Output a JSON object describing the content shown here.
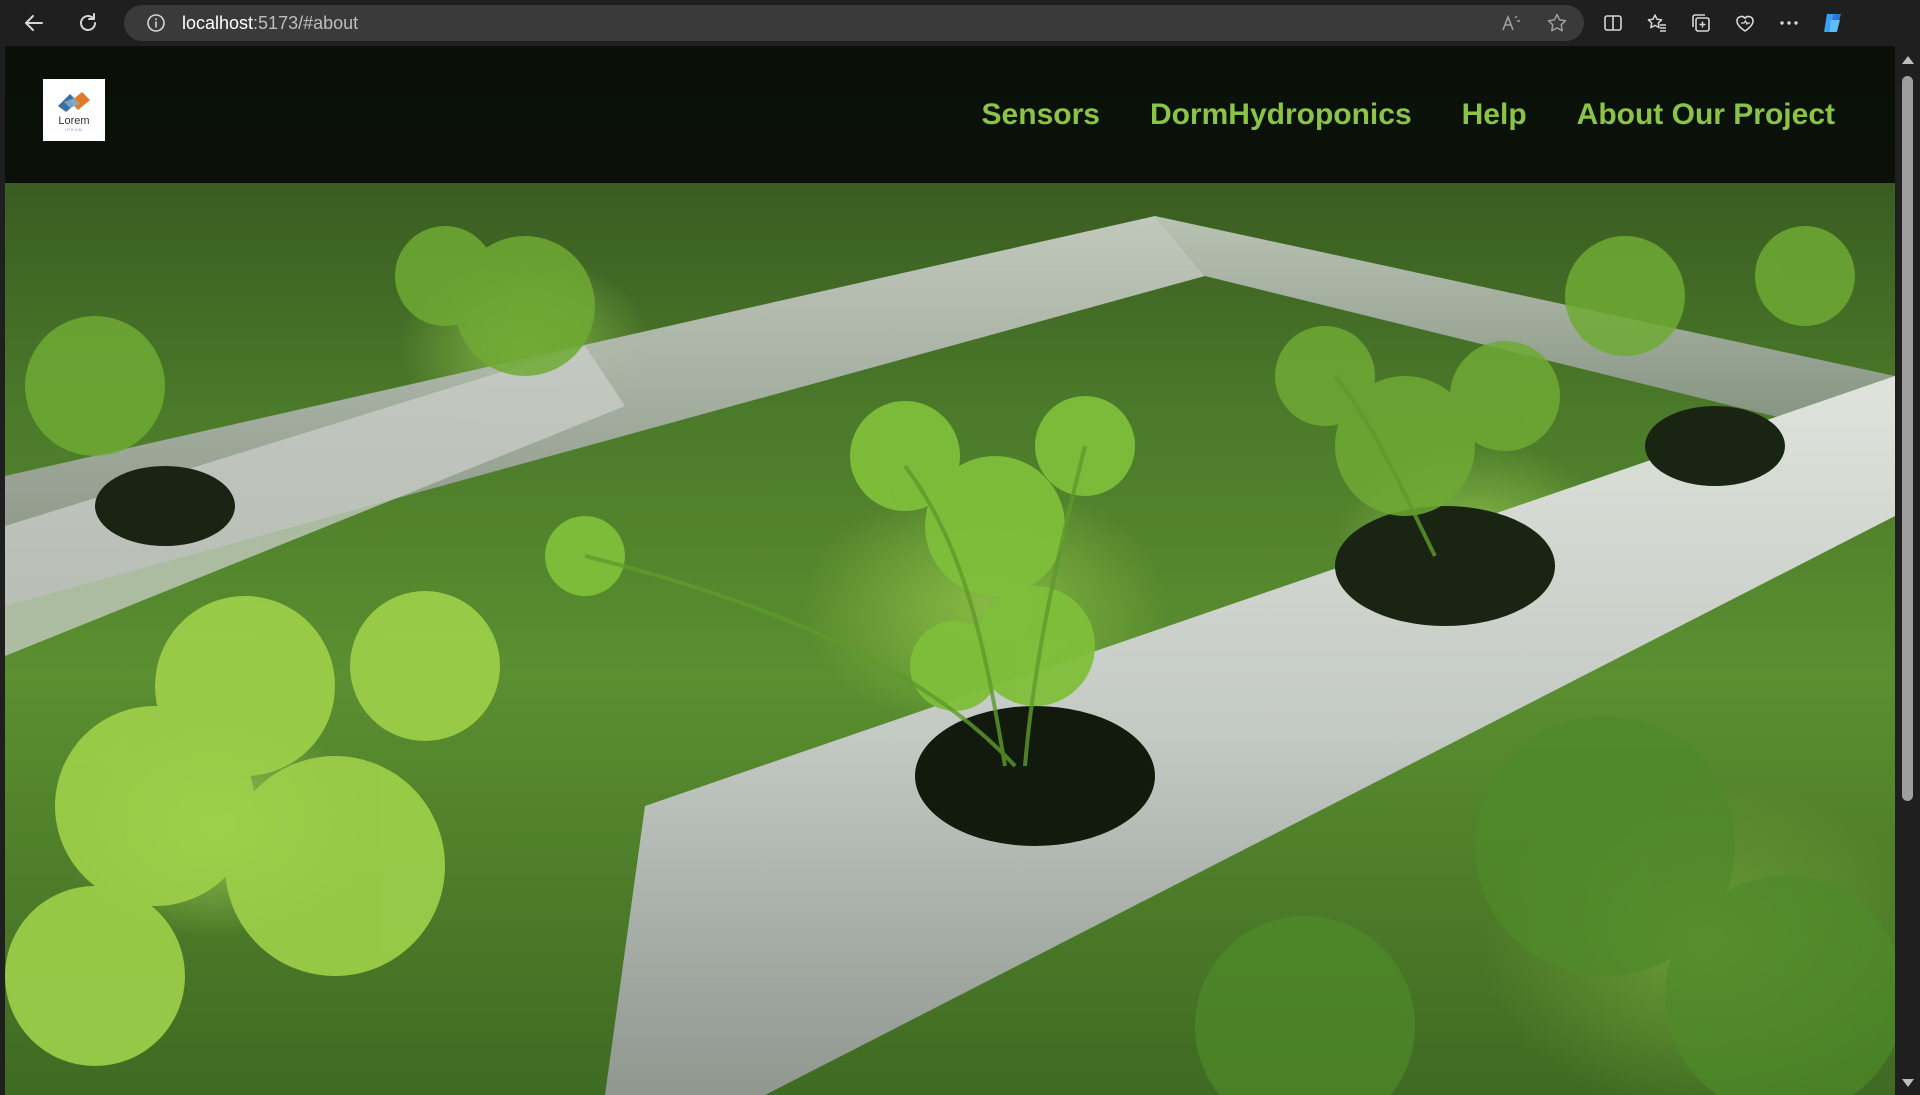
{
  "browser": {
    "url_host": "localhost",
    "url_rest": ":5173/#about"
  },
  "site": {
    "logo_text": "Lorem",
    "logo_sub": "IPSUM"
  },
  "nav": {
    "items": [
      {
        "label": "Sensors"
      },
      {
        "label": "DormHydroponics"
      },
      {
        "label": "Help"
      },
      {
        "label": "About Our Project"
      }
    ]
  },
  "colors": {
    "nav_text": "#8bc34a",
    "header_bg": "#080c06"
  },
  "hero": {
    "image": "hydroponic-pipes-with-cilantro"
  }
}
